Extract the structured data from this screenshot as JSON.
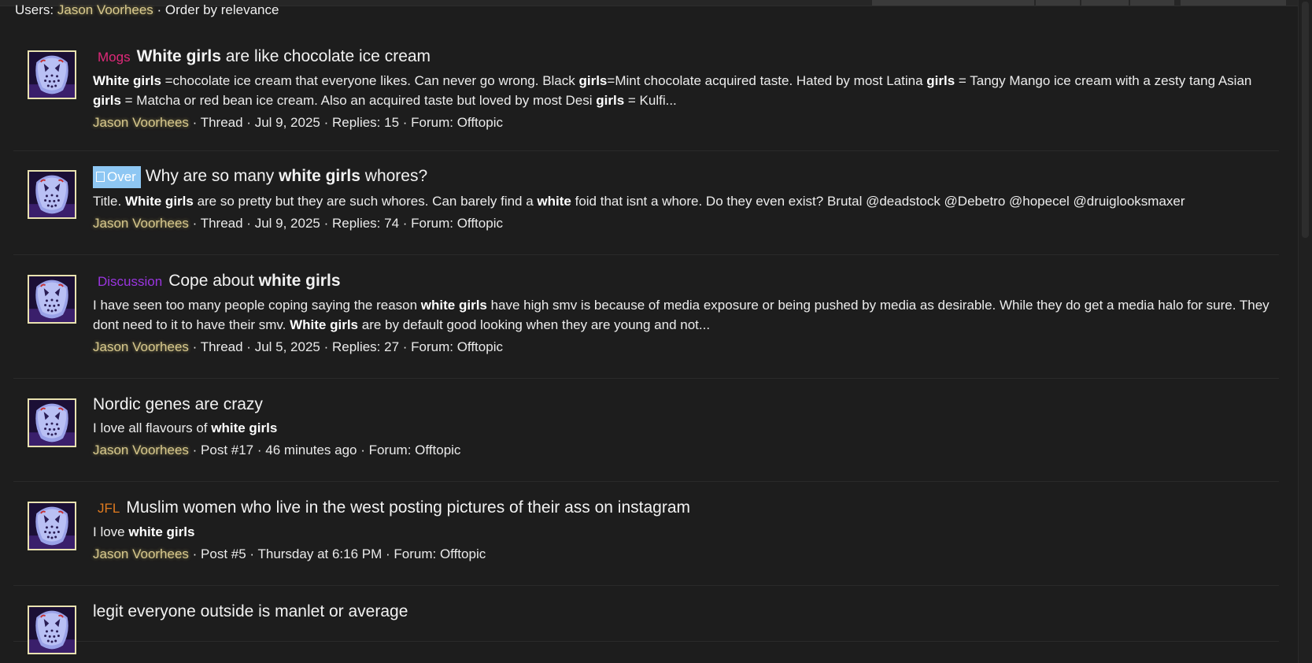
{
  "filter": {
    "users_label": "Users:",
    "user": "Jason Voorhees",
    "order": "· Order by relevance"
  },
  "results": [
    {
      "prefix": "Mogs",
      "title_parts": [
        {
          "t": "White girls",
          "b": true
        },
        {
          "t": " are like chocolate ice cream",
          "b": false
        }
      ],
      "snippet_parts": [
        {
          "t": "White girls",
          "b": true
        },
        {
          "t": " =chocolate ice cream that everyone likes. Can never go wrong. Black ",
          "b": false
        },
        {
          "t": "girls",
          "b": true
        },
        {
          "t": "=Mint chocolate acquired taste. Hated by most Latina ",
          "b": false
        },
        {
          "t": "girls",
          "b": true
        },
        {
          "t": " = Tangy Mango ice cream with a zesty tang Asian ",
          "b": false
        },
        {
          "t": "girls",
          "b": true
        },
        {
          "t": " = Matcha or red bean ice cream. Also an acquired taste but loved by most Desi ",
          "b": false
        },
        {
          "t": "girls",
          "b": true
        },
        {
          "t": " = Kulfi...",
          "b": false
        }
      ],
      "author": "Jason Voorhees",
      "meta": " · Thread · Jul 9, 2025 · Replies: 15 · Forum: Offtopic"
    },
    {
      "prefix": "Over",
      "title_parts": [
        {
          "t": "Why are so many ",
          "b": false
        },
        {
          "t": "white girls",
          "b": true
        },
        {
          "t": " whores?",
          "b": false
        }
      ],
      "snippet_parts": [
        {
          "t": "Title. ",
          "b": false
        },
        {
          "t": "White girls",
          "b": true
        },
        {
          "t": " are so pretty but they are such whores. Can barely find a ",
          "b": false
        },
        {
          "t": "white",
          "b": true
        },
        {
          "t": " foid that isnt a whore. Do they even exist? Brutal @deadstock @Debetro @hopecel @druiglooksmaxer",
          "b": false
        }
      ],
      "author": "Jason Voorhees",
      "meta": " · Thread · Jul 9, 2025 · Replies: 74 · Forum: Offtopic"
    },
    {
      "prefix": "Discussion",
      "title_parts": [
        {
          "t": "Cope about ",
          "b": false
        },
        {
          "t": "white girls",
          "b": true
        }
      ],
      "snippet_parts": [
        {
          "t": "I have seen too many people coping saying the reason ",
          "b": false
        },
        {
          "t": "white girls",
          "b": true
        },
        {
          "t": " have high smv is because of media exposure or being pushed by media as desirable. While they do get a media halo for sure. They dont need to it to have their smv. ",
          "b": false
        },
        {
          "t": "White girls",
          "b": true
        },
        {
          "t": " are by default good looking when they are young and not...",
          "b": false
        }
      ],
      "author": "Jason Voorhees",
      "meta": " · Thread · Jul 5, 2025 · Replies: 27 · Forum: Offtopic"
    },
    {
      "prefix": "",
      "title_parts": [
        {
          "t": "Nordic genes are crazy",
          "b": false
        }
      ],
      "snippet_parts": [
        {
          "t": "I love all flavours of ",
          "b": false
        },
        {
          "t": "white girls",
          "b": true
        }
      ],
      "author": "Jason Voorhees",
      "meta": " · Post #17 · 46 minutes ago · Forum: Offtopic"
    },
    {
      "prefix": "JFL",
      "title_parts": [
        {
          "t": "Muslim women who live in the west posting pictures of their ass on instagram",
          "b": false
        }
      ],
      "snippet_parts": [
        {
          "t": "I love ",
          "b": false
        },
        {
          "t": "white girls",
          "b": true
        }
      ],
      "author": "Jason Voorhees",
      "meta": " · Post #5 · Thursday at 6:16 PM · Forum: Offtopic"
    },
    {
      "prefix": "",
      "title_parts": [
        {
          "t": "legit everyone outside is manlet or average",
          "b": false
        }
      ],
      "snippet_parts": [],
      "author": "",
      "meta": ""
    }
  ]
}
